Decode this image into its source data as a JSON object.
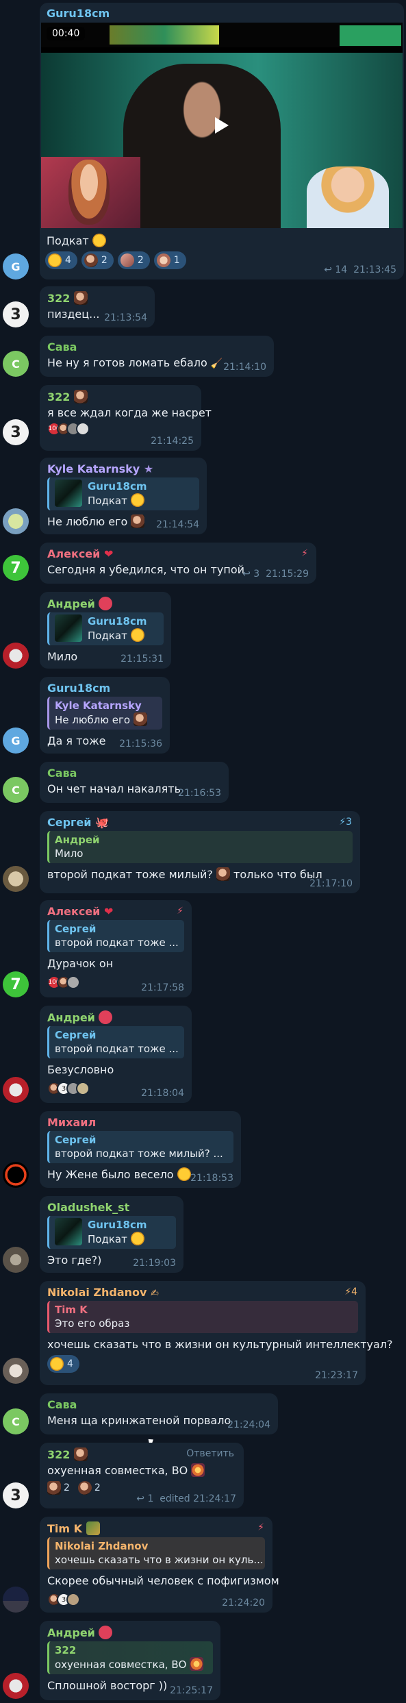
{
  "video": {
    "duration": "00:40"
  },
  "messages": {
    "m1": {
      "sender": "Guru18cm",
      "text": "Подкат",
      "views": "14",
      "time": "21:13:45",
      "avatar": "G",
      "reactions": [
        {
          "count": "4"
        },
        {
          "count": "2"
        },
        {
          "count": "2"
        },
        {
          "count": "1"
        }
      ]
    },
    "m2": {
      "sender": "322",
      "text": "пиздец...",
      "time": "21:13:54"
    },
    "m3": {
      "sender": "Сава",
      "text": "Не ну я готов ломать ебало",
      "time": "21:14:10",
      "avatar": "C"
    },
    "m4": {
      "sender": "322",
      "text": "я все ждал когда же насрет",
      "time": "21:14:25"
    },
    "m5": {
      "sender": "Kyle Katarnsky",
      "quote_name": "Guru18cm",
      "quote_text": "Подкат",
      "text": "Не люблю его",
      "time": "21:14:54"
    },
    "m6": {
      "sender": "Алексей",
      "text": "Сегодня я убедился, что он тупой",
      "replies": "3",
      "time": "21:15:29",
      "avatar": "7"
    },
    "m7": {
      "sender": "Андрей",
      "quote_name": "Guru18cm",
      "quote_text": "Подкат",
      "text": "Мило",
      "time": "21:15:31"
    },
    "m8": {
      "sender": "Guru18cm",
      "quote_name": "Kyle Katarnsky",
      "quote_text": "Не люблю его",
      "text": "Да я тоже",
      "time": "21:15:36",
      "avatar": "G"
    },
    "m9": {
      "sender": "Сава",
      "text": "Он чет начал накалять",
      "time": "21:16:53",
      "avatar": "C"
    },
    "m10": {
      "sender": "Сергей",
      "boost": "3",
      "quote_name": "Андрей",
      "quote_text": "Мило",
      "text_a": "второй подкат тоже милый?",
      "text_b": "только что был",
      "time": "21:17:10"
    },
    "m11": {
      "sender": "Алексей",
      "quote_name": "Сергей",
      "quote_text": "второй подкат тоже ...",
      "text": "Дурачок он",
      "time": "21:17:58",
      "avatar": "7"
    },
    "m12": {
      "sender": "Андрей",
      "quote_name": "Сергей",
      "quote_text": "второй подкат тоже ...",
      "text": "Безусловно",
      "time": "21:18:04"
    },
    "m13": {
      "sender": "Михаил",
      "quote_name": "Сергей",
      "quote_text": "второй подкат тоже милый? ...",
      "text": "Ну Жене было весело",
      "time": "21:18:53"
    },
    "m14": {
      "sender": "Oladushek_st",
      "quote_name": "Guru18cm",
      "quote_text": "Подкат",
      "text": "Это где?)",
      "time": "21:19:03"
    },
    "m15": {
      "sender": "Nikolai Zhdanov",
      "boost": "4",
      "quote_name": "Tim K",
      "quote_text": "Это его образ",
      "text": "хочешь сказать что в жизни он культурный интеллектуал?",
      "reaction_count": "4",
      "time": "21:23:17"
    },
    "m16": {
      "sender": "Сава",
      "text": "Меня ща кринжатеной порвало",
      "time": "21:24:04",
      "avatar": "C"
    },
    "m17": {
      "sender": "322",
      "reply_label": "Ответить",
      "text": "охуенная совместка, ВО",
      "reactions": [
        {
          "count": "2"
        },
        {
          "count": "2"
        }
      ],
      "replies": "1",
      "time": "edited 21:24:17"
    },
    "m18": {
      "sender": "Tim K",
      "quote_name": "Nikolai Zhdanov",
      "quote_text": "хочешь сказать что в жизни он куль...",
      "text": "Скорее обычный человек с пофигизмом",
      "time": "21:24:20"
    },
    "m19": {
      "sender": "Андрей",
      "quote_name": "322",
      "quote_text": "охуенная совместка, ВО",
      "text": "Сплошной восторг ))",
      "time": "21:25:17"
    }
  }
}
